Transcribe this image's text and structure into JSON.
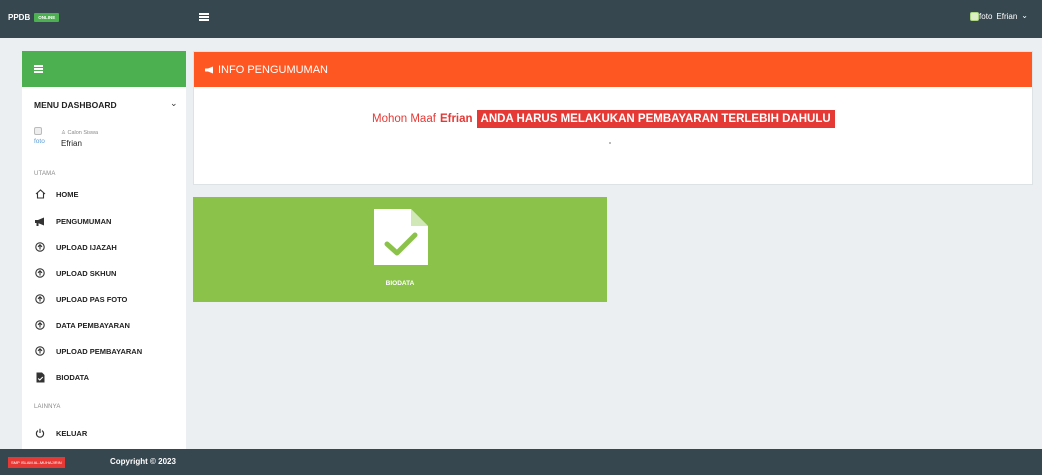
{
  "topbar": {
    "brand": "PPDB",
    "online_badge": "ONLINE",
    "user_img_alt": "foto",
    "user_name": "Efrian",
    "chevron": "⌄"
  },
  "sidebar": {
    "menu_title": "MENU DASHBOARD",
    "chevron": "⌄",
    "profile": {
      "img_alt": "foto",
      "role": "Calon Siswa",
      "name": "Efrian"
    },
    "section_main": "UTAMA",
    "items": [
      {
        "label": "HOME",
        "icon": "home-icon"
      },
      {
        "label": "PENGUMUMAN",
        "icon": "bullhorn-icon"
      },
      {
        "label": "UPLOAD IJAZAH",
        "icon": "upload-circle-icon"
      },
      {
        "label": "UPLOAD SKHUN",
        "icon": "upload-circle-icon"
      },
      {
        "label": "UPLOAD PAS FOTO",
        "icon": "upload-circle-icon"
      },
      {
        "label": "DATA PEMBAYARAN",
        "icon": "upload-circle-icon"
      },
      {
        "label": "UPLOAD PEMBAYARAN",
        "icon": "upload-circle-icon"
      },
      {
        "label": "BIODATA",
        "icon": "file-check-icon"
      }
    ],
    "section_other": "LAINNYA",
    "logout_label": "KELUAR"
  },
  "info": {
    "title": "INFO PENGUMUMAN",
    "msg_prefix": "Mohon Maaf",
    "msg_name": "Efrian",
    "msg_highlight": "ANDA HARUS MELAKUKAN PEMBAYARAN TERLEBIH DAHULU"
  },
  "tile": {
    "label": "BIODATA"
  },
  "footer": {
    "school": "SMP ISLAM AL-MUHAJIRIN",
    "copyright": "Copyright © 2023"
  },
  "colors": {
    "navbar": "#37474f",
    "sidebar_head": "#4caf50",
    "info_head": "#ff5722",
    "highlight": "#e53935",
    "tile": "#8bc34a"
  }
}
